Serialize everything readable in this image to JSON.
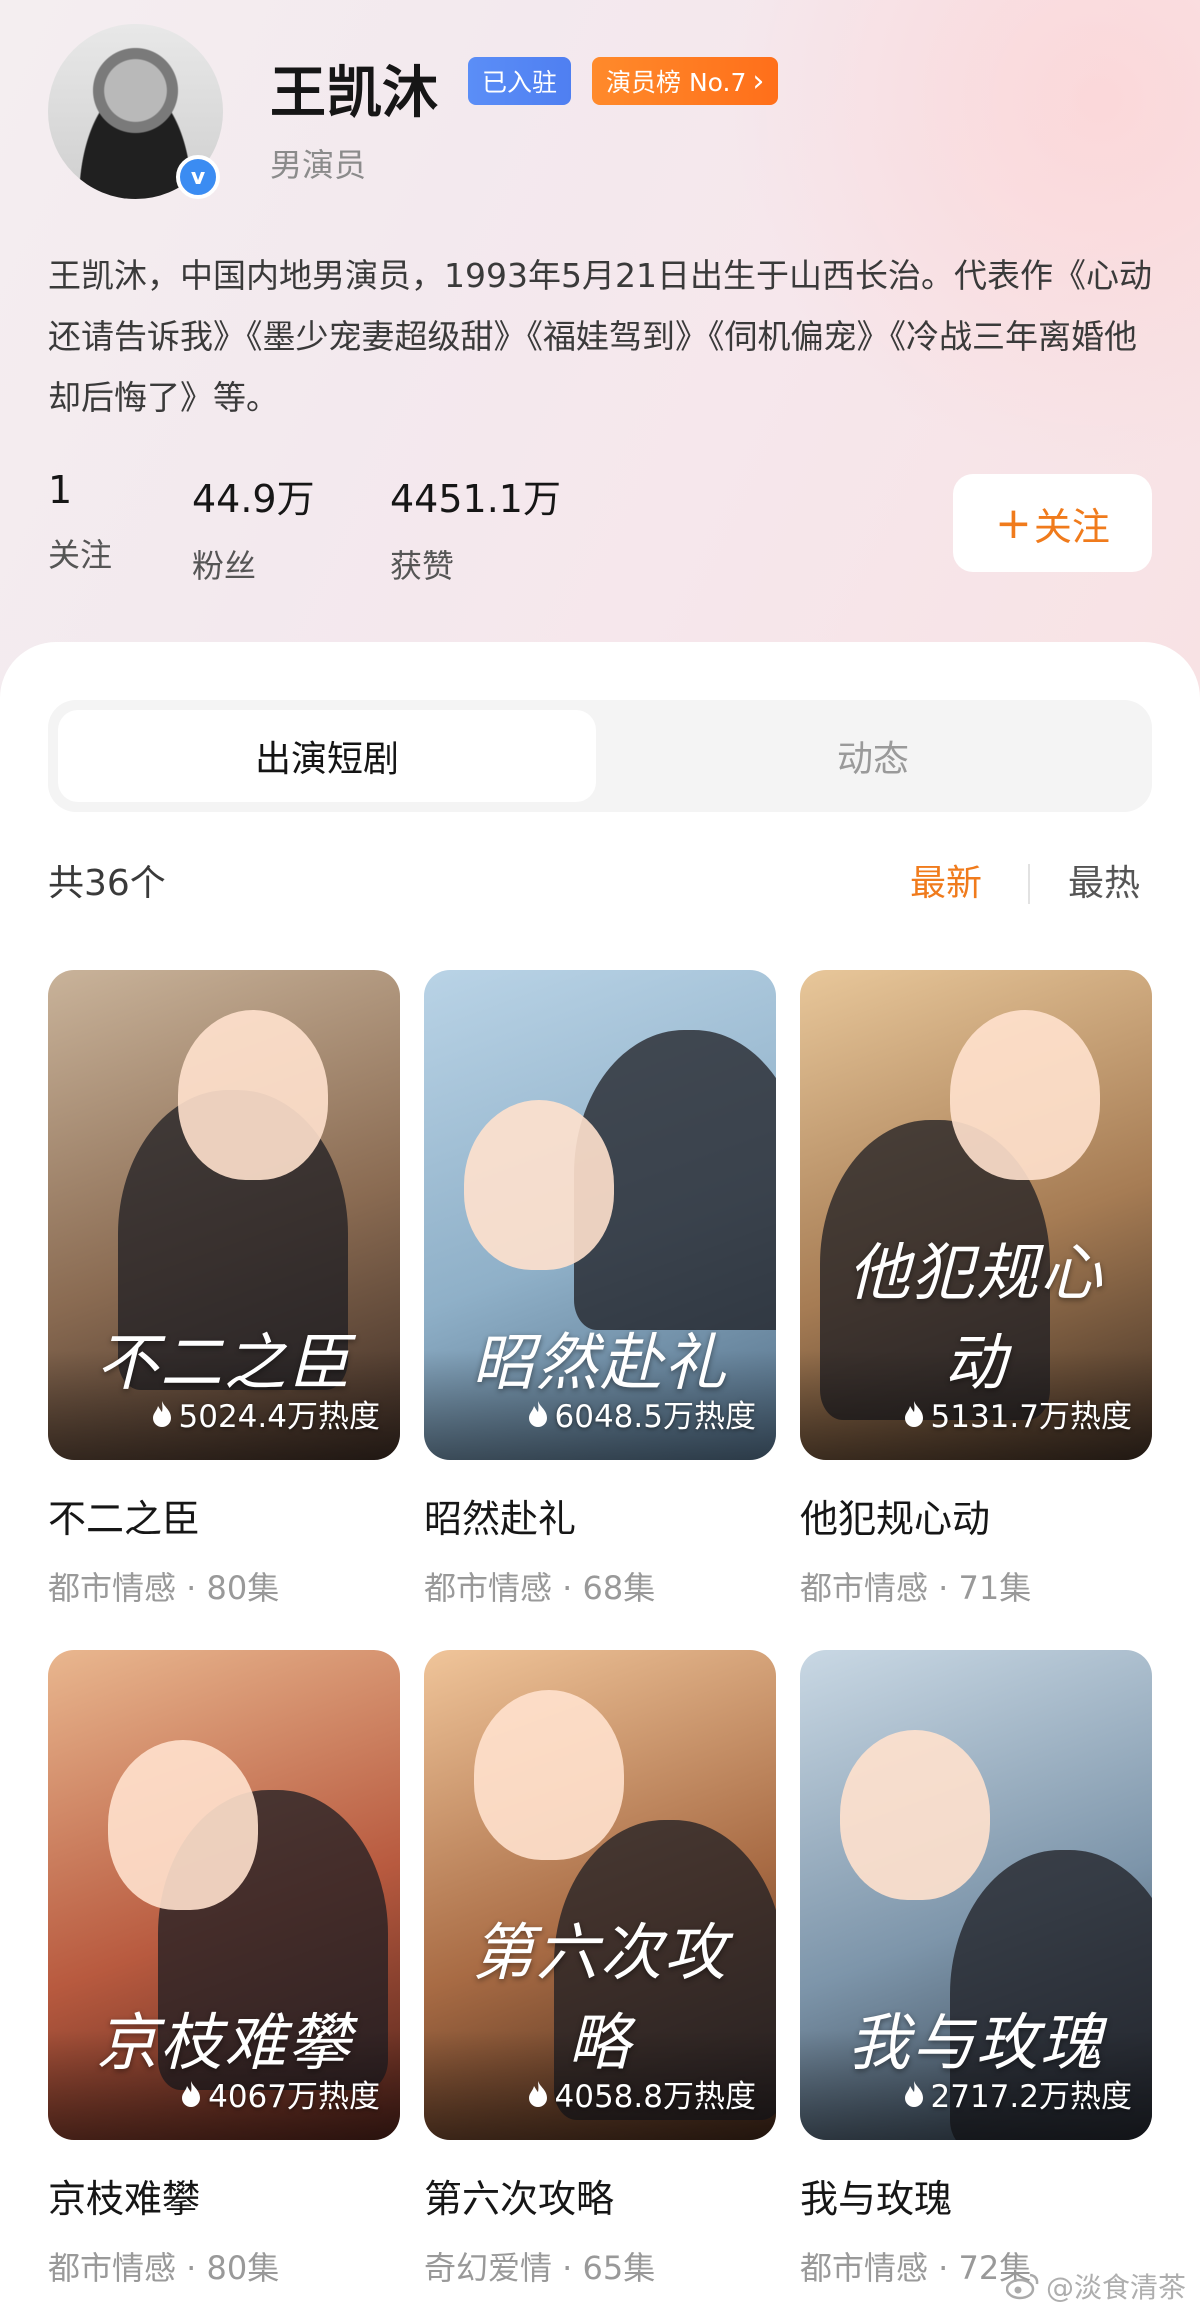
{
  "profile": {
    "name": "王凯沐",
    "badge_settled": "已入驻",
    "badge_rank": "演员榜 No.7",
    "badge_rank_chevron": "›",
    "subtitle": "男演员",
    "verified_mark": "v",
    "bio": "王凯沐，中国内地男演员，1993年5月21日出生于山西长治。代表作《心动还请告诉我》《墨少宠妻超级甜》《福娃驾到》《伺机偏宠》《冷战三年离婚他却后悔了》等。",
    "stats": [
      {
        "value": "1",
        "label": "关注"
      },
      {
        "value": "44.9万",
        "label": "粉丝"
      },
      {
        "value": "4451.1万",
        "label": "获赞"
      }
    ],
    "follow_plus": "+",
    "follow_label": "关注"
  },
  "tabs": {
    "active": "出演短剧",
    "inactive": "动态"
  },
  "list": {
    "count_label": "共36个",
    "sort_new": "最新",
    "sort_hot": "最热"
  },
  "dramas": [
    {
      "title": "不二之臣",
      "meta": "都市情感 · 80集",
      "heat": "5024.4万热度",
      "poster_text": "不二之臣",
      "colors": [
        "#c9b39a",
        "#8a6b52",
        "#3a2a22"
      ]
    },
    {
      "title": "昭然赴礼",
      "meta": "都市情感 · 68集",
      "heat": "6048.5万热度",
      "poster_text": "昭然赴礼",
      "colors": [
        "#b9d3e6",
        "#8fb0c8",
        "#4f6a82"
      ]
    },
    {
      "title": "他犯规心动",
      "meta": "都市情感 · 71集",
      "heat": "5131.7万热度",
      "poster_text": "他犯规心动",
      "colors": [
        "#e8c79a",
        "#a67c54",
        "#3b2c22"
      ]
    },
    {
      "title": "京枝难攀",
      "meta": "都市情感 · 80集",
      "heat": "4067万热度",
      "poster_text": "京枝难攀",
      "colors": [
        "#e9b78f",
        "#b85a3f",
        "#4a2019"
      ]
    },
    {
      "title": "第六次攻略",
      "meta": "奇幻爱情 · 65集",
      "heat": "4058.8万热度",
      "poster_text": "第六次攻略",
      "colors": [
        "#f0c59a",
        "#a86b44",
        "#3b2418"
      ]
    },
    {
      "title": "我与玫瑰",
      "meta": "都市情感 · 72集",
      "heat": "2717.2万热度",
      "poster_text": "我与玫瑰",
      "colors": [
        "#c9d8e4",
        "#7d95aa",
        "#2e3a47"
      ]
    }
  ],
  "watermark": "@淡食清茶",
  "icons": {
    "verified": "verified-check-icon",
    "chevron": "chevron-right-icon",
    "flame": "flame-icon",
    "weibo": "weibo-logo-icon"
  },
  "accent_color": "#f07b1c"
}
